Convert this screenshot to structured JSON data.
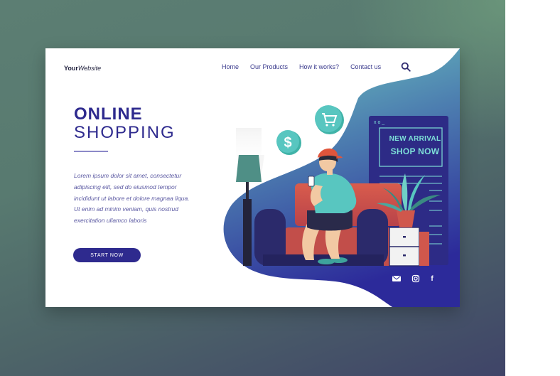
{
  "header": {
    "logo_bold": "Your",
    "logo_italic": "Website",
    "nav": [
      "Home",
      "Our Products",
      "How it works?",
      "Contact us"
    ]
  },
  "hero": {
    "title_line1": "ONLINE",
    "title_line2": "SHOPPING",
    "body": "Lorem ipsum dolor sit amet, consectetur adipiscing elit, sed do eiusmod tempor incididunt ut labore et dolore magnaa liqua. Ut enim ad minim veniam, quis nostrud exercitation ullamco laboris",
    "cta": "START NOW"
  },
  "poster": {
    "window_controls": "x o _",
    "line1": "NEW ARRIVAL",
    "line2": "SHOP NOW"
  },
  "badges": {
    "dollar": "$"
  },
  "social": {
    "facebook": "f"
  },
  "colors": {
    "brand": "#2e2a8e",
    "teal": "#54c8bf",
    "sofa": "#d0574c",
    "shirt": "#58c6c0",
    "cap": "#e0553c"
  }
}
